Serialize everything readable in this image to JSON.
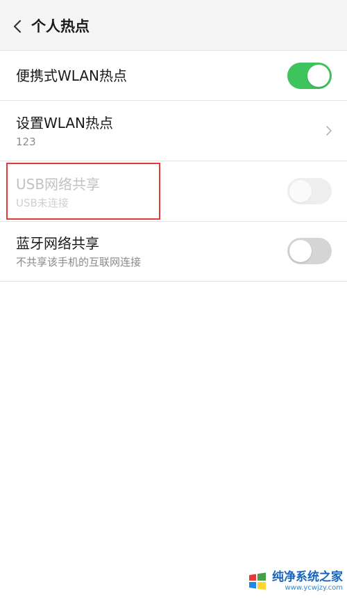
{
  "header": {
    "title": "个人热点"
  },
  "settings": [
    {
      "title": "便携式WLAN热点",
      "subtitle": "",
      "control": "toggle",
      "state": "on",
      "enabled": true
    },
    {
      "title": "设置WLAN热点",
      "subtitle": "123",
      "control": "chevron",
      "enabled": true
    },
    {
      "title": "USB网络共享",
      "subtitle": "USB未连接",
      "control": "toggle",
      "state": "off",
      "enabled": false
    },
    {
      "title": "蓝牙网络共享",
      "subtitle": "不共享该手机的互联网连接",
      "control": "toggle",
      "state": "off",
      "enabled": true
    }
  ],
  "colors": {
    "toggle_on": "#3fc35d",
    "toggle_off": "#d5d5d5",
    "highlight": "#e53935",
    "header_bg": "#f5f5f5"
  },
  "watermark": {
    "title": "纯净系统之家",
    "url": "www.ycwjzy.com"
  }
}
